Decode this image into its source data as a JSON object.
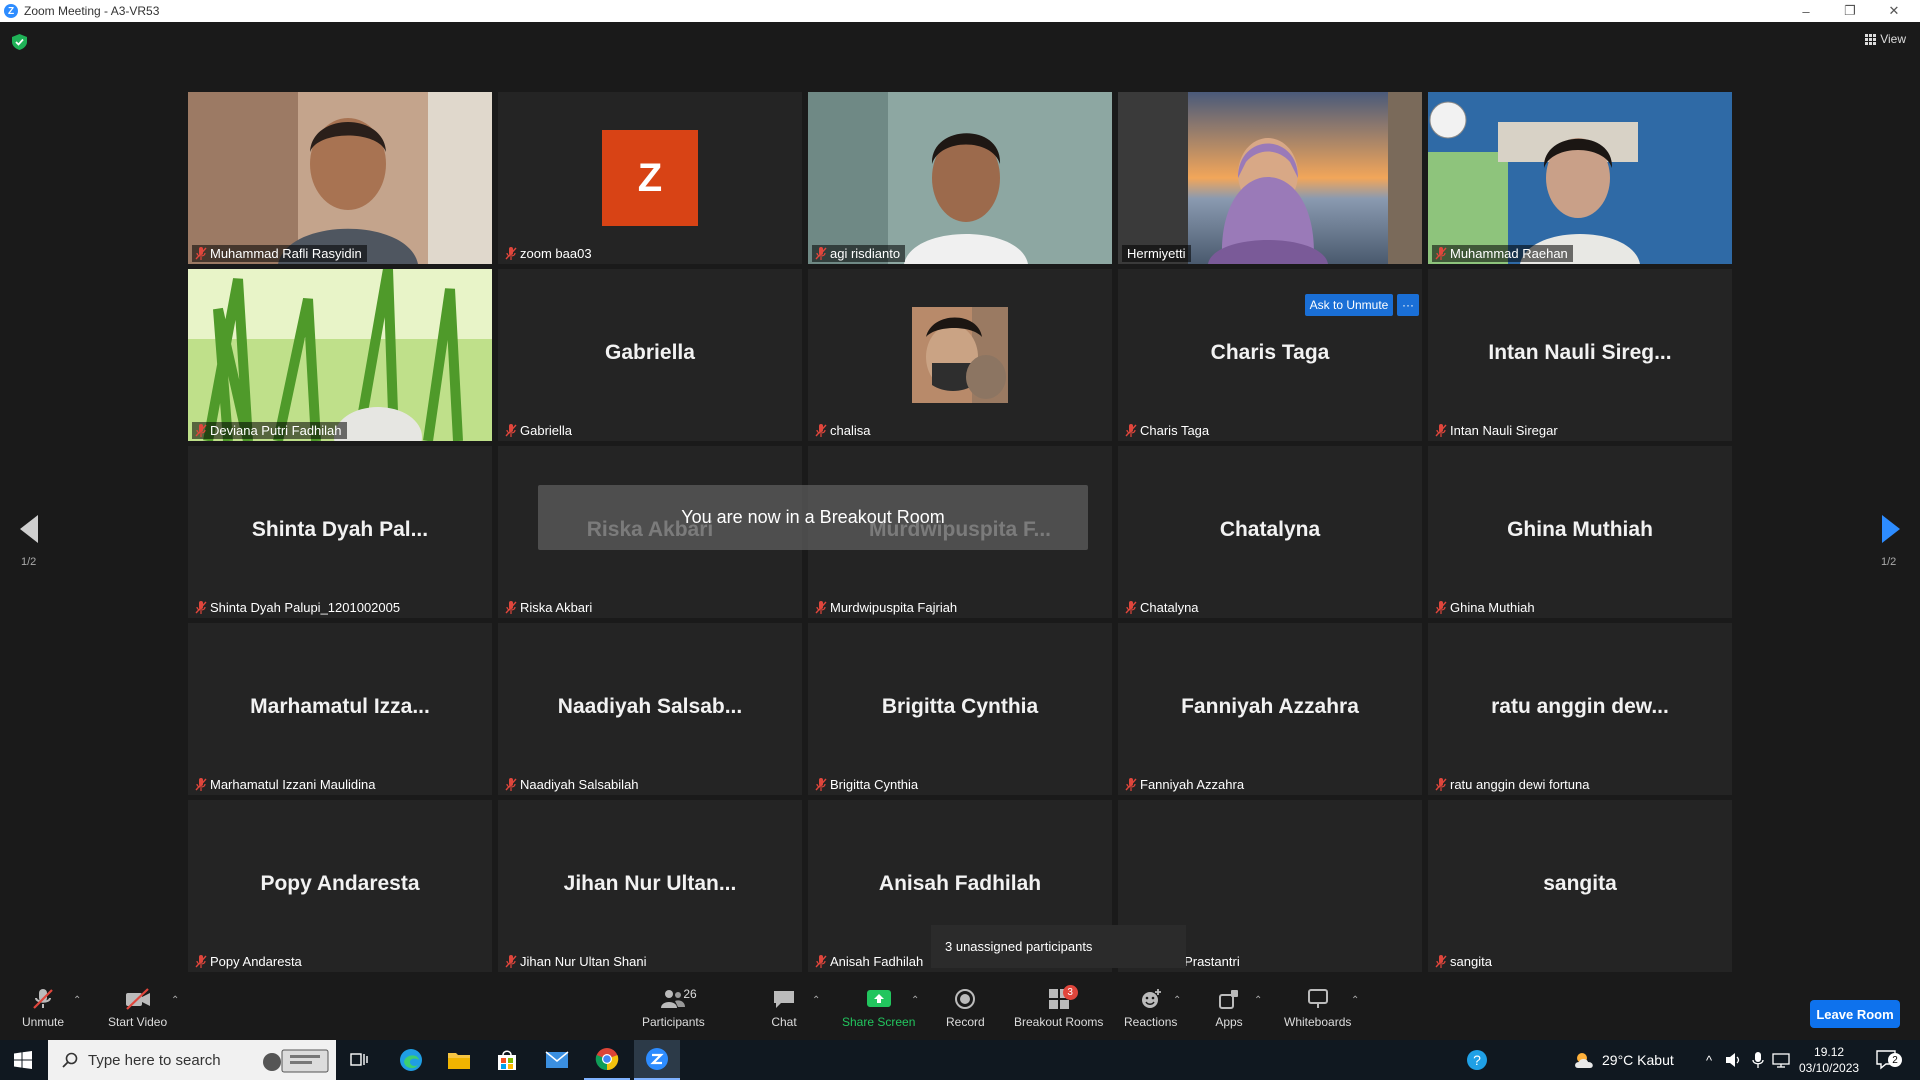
{
  "window": {
    "title": "Zoom Meeting - A3-VR53",
    "minimize": "–",
    "restore": "❐",
    "close": "✕"
  },
  "view_label": "View",
  "pages": {
    "left": "1/2",
    "right": "1/2"
  },
  "toast": "You are now in a Breakout Room",
  "unassigned_popup": "3 unassigned participants",
  "ask_to_unmute": "Ask to Unmute",
  "more_options": "···",
  "tiles": [
    {
      "label": "Muhammad Rafli Rasyidin",
      "big": "",
      "kind": "video"
    },
    {
      "label": "zoom baa03",
      "big": "",
      "kind": "avatar-z"
    },
    {
      "label": "agi risdianto",
      "big": "",
      "kind": "video"
    },
    {
      "label": "Hermiyetti",
      "big": "",
      "kind": "video-speaker"
    },
    {
      "label": "Muhammad Raehan",
      "big": "",
      "kind": "video"
    },
    {
      "label": "Deviana Putri Fadhilah",
      "big": "",
      "kind": "video-grass"
    },
    {
      "label": "Gabriella",
      "big": "Gabriella",
      "kind": "name"
    },
    {
      "label": "chalisa",
      "big": "",
      "kind": "avatar-photo"
    },
    {
      "label": "Charis Taga",
      "big": "Charis Taga",
      "kind": "name"
    },
    {
      "label": "Intan Nauli Siregar",
      "big": "Intan Nauli Sireg...",
      "kind": "name"
    },
    {
      "label": "Shinta Dyah Palupi_1201002005",
      "big": "Shinta Dyah Pal...",
      "kind": "name"
    },
    {
      "label": "Riska Akbari",
      "big": "Riska Akbari",
      "kind": "name"
    },
    {
      "label": "Murdwipuspita Fajriah",
      "big": "Murdwipuspita F...",
      "kind": "name"
    },
    {
      "label": "Chatalyna",
      "big": "Chatalyna",
      "kind": "name"
    },
    {
      "label": "Ghina Muthiah",
      "big": "Ghina Muthiah",
      "kind": "name"
    },
    {
      "label": "Marhamatul Izzani Maulidina",
      "big": "Marhamatul Izza...",
      "kind": "name"
    },
    {
      "label": "Naadiyah Salsabilah",
      "big": "Naadiyah Salsab...",
      "kind": "name"
    },
    {
      "label": "Brigitta Cynthia",
      "big": "Brigitta Cynthia",
      "kind": "name"
    },
    {
      "label": "Fanniyah Azzahra",
      "big": "Fanniyah Azzahra",
      "kind": "name"
    },
    {
      "label": "ratu anggin dewi fortuna",
      "big": "ratu anggin dew...",
      "kind": "name"
    },
    {
      "label": "Popy Andaresta",
      "big": "Popy Andaresta",
      "kind": "name"
    },
    {
      "label": "Jihan Nur Ultan Shani",
      "big": "Jihan Nur Ultan...",
      "kind": "name"
    },
    {
      "label": "Anisah Fadhilah",
      "big": "Anisah Fadhilah",
      "kind": "name"
    },
    {
      "label": "wianita Prastantri",
      "big": "",
      "kind": "name-covered"
    },
    {
      "label": "sangita",
      "big": "sangita",
      "kind": "name"
    }
  ],
  "toolbar": {
    "unmute": "Unmute",
    "start_video": "Start Video",
    "participants": "Participants",
    "participants_count": "26",
    "chat": "Chat",
    "share_screen": "Share Screen",
    "record": "Record",
    "breakout_rooms": "Breakout Rooms",
    "breakout_badge": "3",
    "reactions": "Reactions",
    "apps": "Apps",
    "whiteboards": "Whiteboards",
    "leave_room": "Leave Room"
  },
  "taskbar": {
    "search_placeholder": "Type here to search",
    "weather": "29°C  Kabut",
    "time": "19.12",
    "date": "03/10/2023",
    "notification_count": "2"
  },
  "colors": {
    "accent": "#0e72ed",
    "speaker_border": "#f4f47a",
    "share_green": "#22c55e",
    "muted_red": "#e0463c",
    "avatar_orange": "#d84315"
  }
}
